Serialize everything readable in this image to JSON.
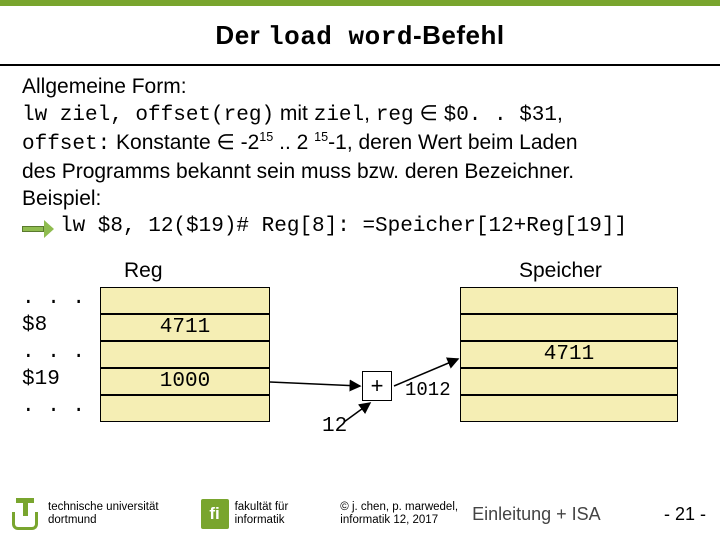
{
  "title": {
    "pre": "Der ",
    "cmd": "load word",
    "post": "-Befehl"
  },
  "body": {
    "l1": "Allgemeine Form:",
    "l2a": "lw ziel, offset(reg)",
    "l2b": " mit ",
    "l2c": "ziel",
    "l2d": ", ",
    "l2e": "reg",
    "l2f": " ∈ ",
    "l2g": "$0. . $31",
    "l2h": ",",
    "l3a": "offset:",
    "l3b": " Konstante ∈ -2",
    "l3c": "15",
    "l3d": " .. 2 ",
    "l3e": "15",
    "l3f": "-1, deren Wert beim Laden",
    "l4": "des Programms bekannt sein muss bzw. deren Bezeichner.",
    "l5": "Beispiel:",
    "ex": "lw $8, 12($19)# Reg[8]: =Speicher[12+Reg[19]]"
  },
  "diagram": {
    "reg_label": "Reg",
    "mem_label": "Speicher",
    "rows": {
      "d1": ". . .",
      "r8": "$8",
      "d2": ". . .",
      "r19": "$19",
      "d3": ". . ."
    },
    "reg8_val": "4711",
    "reg19_val": "1000",
    "mem_val": "4711",
    "plus": "+",
    "offset": "12",
    "addr": "1012"
  },
  "footer": {
    "uni1": "technische universität",
    "uni2": "dortmund",
    "fac1": "fakultät für",
    "fac2": "informatik",
    "copy1": "© j. chen, p. marwedel,",
    "copy2": "informatik 12,  2017",
    "lecture": "Einleitung + ISA",
    "page_pre": "-  ",
    "page_num": "21",
    "page_post": " -"
  }
}
